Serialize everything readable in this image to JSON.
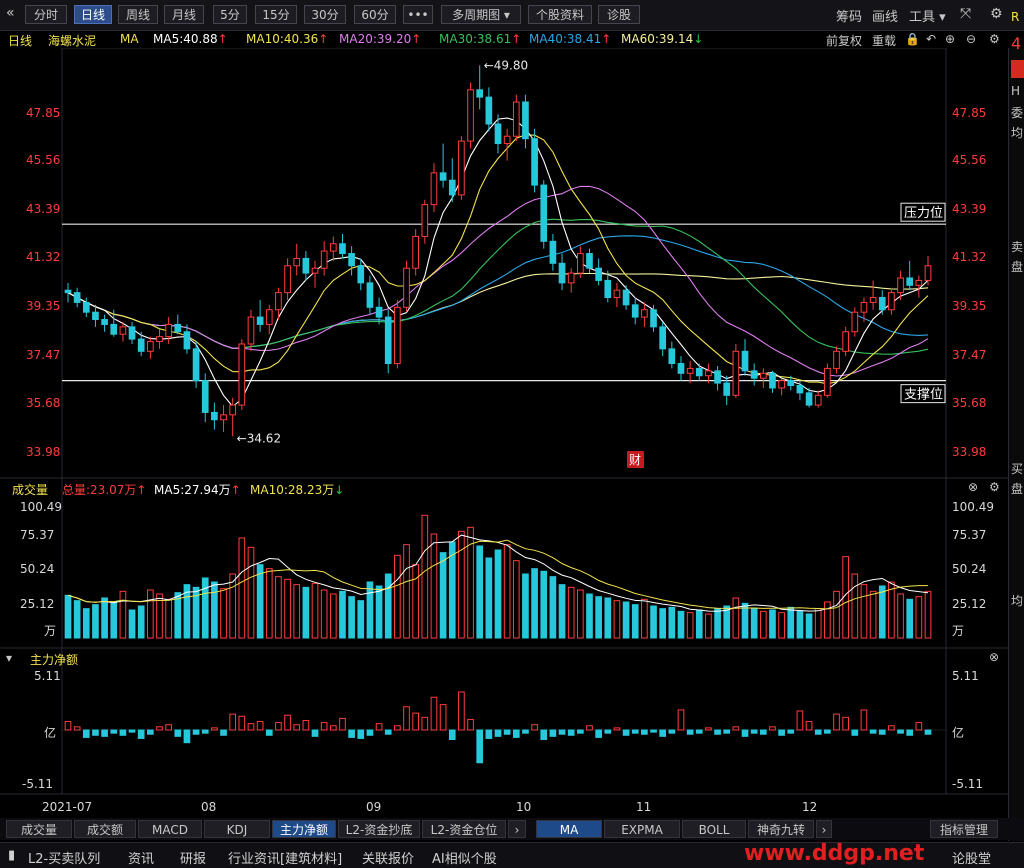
{
  "toolbar": {
    "back_icon": "«",
    "periods": [
      "分时",
      "日线",
      "周线",
      "月线",
      "5分",
      "15分",
      "30分",
      "60分"
    ],
    "active_period": "日线",
    "more": "•••",
    "multi_period": "多周期图",
    "stock_info": "个股资料",
    "diagnose": "诊股",
    "right_items": [
      "筹码",
      "画线",
      "工具"
    ]
  },
  "legend": {
    "period": "日线",
    "stock": "海螺水泥",
    "ma": "MA",
    "items": [
      {
        "text": "MA5:40.88",
        "arrow": "↑",
        "color": "#ffffff"
      },
      {
        "text": "MA10:40.36",
        "arrow": "↑",
        "color": "#f2e34c"
      },
      {
        "text": "MA20:39.20",
        "arrow": "↑",
        "color": "#e07cf0"
      },
      {
        "text": "MA30:38.61",
        "arrow": "↑",
        "color": "#36c05a"
      },
      {
        "text": "MA40:38.41",
        "arrow": "↑",
        "color": "#2ba6e6"
      },
      {
        "text": "MA60:39.14",
        "arrow": "↓",
        "color": "#f5f09c"
      }
    ],
    "right": [
      "前复权",
      "重载"
    ]
  },
  "price_axis": [
    "47.85",
    "45.56",
    "43.39",
    "41.32",
    "39.35",
    "37.47",
    "35.68",
    "33.98"
  ],
  "annotations": {
    "high_label": "←49.80",
    "low_label": "←34.62",
    "pressure": "压力位",
    "support": "支撑位",
    "fin_badge": "财"
  },
  "volume_panel": {
    "title": "成交量",
    "total": "总量:23.07万",
    "total_arrow": "↑",
    "ma5": "MA5:27.94万",
    "ma5_arrow": "↑",
    "ma10": "MA10:28.23万",
    "ma10_arrow": "↓",
    "axis": [
      "100.49",
      "75.37",
      "50.24",
      "25.12"
    ],
    "unit": "万"
  },
  "flow_panel": {
    "title": "主力净额",
    "axis_top": "5.11",
    "axis_mid": "亿",
    "axis_bottom": "-5.11"
  },
  "x_axis": [
    "2021-07",
    "08",
    "09",
    "10",
    "11",
    "12"
  ],
  "indicator_tabs": [
    "成交量",
    "成交额",
    "MACD",
    "KDJ",
    "主力净额",
    "L2-资金抄底",
    "L2-资金仓位"
  ],
  "active_indicator": "主力净额",
  "ma_tabs": [
    "MA",
    "EXPMA",
    "BOLL",
    "神奇九转"
  ],
  "active_ma_tab": "MA",
  "indicator_manage": "指标管理",
  "status_bar": [
    "L2-买卖队列",
    "资讯",
    "研报",
    "行业资讯[建筑材料]",
    "关联报价",
    "AI相似个股"
  ],
  "status_right": "论股堂",
  "watermark": "www.ddgp.net",
  "right_strip": [
    "R",
    "4",
    "H",
    "委",
    "均",
    "卖",
    "盘",
    "买",
    "盘",
    "均"
  ],
  "colors": {
    "up": "#ff3c3c",
    "down": "#28c8dc",
    "bg": "#000000",
    "accent": "#2d4c8c"
  },
  "chart_data": {
    "type": "candlestick",
    "price_range": [
      33.98,
      49.8
    ],
    "high": 49.8,
    "low": 34.62,
    "pressure_level": 43.3,
    "support_level": 36.9,
    "x_labels": [
      "2021-07",
      "08",
      "09",
      "10",
      "11",
      "12"
    ],
    "ohlc": [
      [
        40.6,
        40.9,
        40.1,
        40.5
      ],
      [
        40.5,
        40.7,
        39.9,
        40.1
      ],
      [
        40.1,
        40.3,
        39.5,
        39.7
      ],
      [
        39.7,
        40.0,
        39.1,
        39.4
      ],
      [
        39.4,
        39.6,
        38.9,
        39.2
      ],
      [
        39.2,
        39.8,
        38.7,
        38.8
      ],
      [
        38.8,
        39.3,
        38.5,
        39.1
      ],
      [
        39.1,
        39.3,
        38.4,
        38.6
      ],
      [
        38.6,
        38.9,
        37.9,
        38.1
      ],
      [
        38.1,
        38.7,
        37.8,
        38.5
      ],
      [
        38.5,
        39.0,
        38.2,
        38.7
      ],
      [
        38.7,
        39.5,
        38.4,
        39.2
      ],
      [
        39.2,
        39.6,
        38.8,
        38.9
      ],
      [
        38.9,
        39.2,
        38.0,
        38.2
      ],
      [
        38.2,
        38.5,
        36.6,
        36.9
      ],
      [
        36.9,
        37.2,
        35.2,
        35.6
      ],
      [
        35.6,
        36.0,
        34.9,
        35.3
      ],
      [
        35.3,
        35.9,
        34.8,
        35.5
      ],
      [
        35.5,
        36.2,
        34.62,
        35.9
      ],
      [
        35.9,
        38.6,
        35.7,
        38.4
      ],
      [
        38.4,
        39.8,
        38.1,
        39.5
      ],
      [
        39.5,
        40.2,
        38.9,
        39.2
      ],
      [
        39.2,
        40.0,
        38.8,
        39.8
      ],
      [
        39.8,
        40.7,
        39.4,
        40.5
      ],
      [
        40.5,
        41.9,
        40.2,
        41.6
      ],
      [
        41.6,
        42.5,
        41.2,
        41.9
      ],
      [
        41.9,
        42.2,
        41.0,
        41.3
      ],
      [
        41.3,
        41.8,
        40.7,
        41.5
      ],
      [
        41.5,
        42.6,
        41.2,
        42.2
      ],
      [
        42.2,
        42.8,
        41.8,
        42.5
      ],
      [
        42.5,
        42.9,
        41.9,
        42.1
      ],
      [
        42.1,
        42.4,
        41.2,
        41.6
      ],
      [
        41.6,
        41.9,
        40.6,
        40.9
      ],
      [
        40.9,
        41.2,
        39.6,
        39.9
      ],
      [
        39.9,
        40.3,
        39.2,
        39.5
      ],
      [
        39.5,
        39.8,
        37.2,
        37.6
      ],
      [
        37.6,
        40.2,
        37.4,
        39.9
      ],
      [
        39.9,
        41.8,
        39.7,
        41.5
      ],
      [
        41.5,
        43.1,
        41.2,
        42.8
      ],
      [
        42.8,
        44.3,
        42.5,
        44.1
      ],
      [
        44.1,
        45.8,
        43.8,
        45.4
      ],
      [
        45.4,
        46.6,
        44.8,
        45.1
      ],
      [
        45.1,
        46.0,
        44.2,
        44.5
      ],
      [
        44.5,
        46.9,
        44.3,
        46.7
      ],
      [
        46.7,
        49.1,
        46.4,
        48.8
      ],
      [
        48.8,
        49.8,
        48.0,
        48.5
      ],
      [
        48.5,
        48.9,
        47.1,
        47.4
      ],
      [
        47.4,
        47.8,
        46.2,
        46.6
      ],
      [
        46.6,
        47.2,
        45.9,
        46.9
      ],
      [
        46.9,
        48.6,
        46.7,
        48.3
      ],
      [
        48.3,
        48.6,
        46.4,
        46.8
      ],
      [
        46.8,
        47.2,
        44.6,
        44.9
      ],
      [
        44.9,
        45.1,
        42.3,
        42.6
      ],
      [
        42.6,
        42.9,
        41.4,
        41.7
      ],
      [
        41.7,
        42.1,
        40.6,
        40.9
      ],
      [
        40.9,
        41.5,
        40.5,
        41.3
      ],
      [
        41.3,
        42.4,
        41.1,
        42.1
      ],
      [
        42.1,
        42.3,
        41.3,
        41.5
      ],
      [
        41.5,
        41.9,
        40.8,
        41.0
      ],
      [
        41.0,
        41.4,
        40.1,
        40.3
      ],
      [
        40.3,
        40.9,
        39.9,
        40.6
      ],
      [
        40.6,
        40.8,
        39.8,
        40.0
      ],
      [
        40.0,
        40.3,
        39.2,
        39.5
      ],
      [
        39.5,
        40.1,
        39.1,
        39.8
      ],
      [
        39.8,
        40.0,
        38.9,
        39.1
      ],
      [
        39.1,
        39.3,
        37.9,
        38.2
      ],
      [
        38.2,
        38.5,
        37.4,
        37.6
      ],
      [
        37.6,
        37.9,
        36.9,
        37.2
      ],
      [
        37.2,
        37.7,
        36.8,
        37.4
      ],
      [
        37.4,
        37.6,
        36.9,
        37.1
      ],
      [
        37.1,
        37.6,
        36.8,
        37.3
      ],
      [
        37.3,
        37.5,
        36.5,
        36.8
      ],
      [
        36.8,
        37.1,
        35.9,
        36.3
      ],
      [
        36.3,
        38.4,
        36.2,
        38.1
      ],
      [
        38.1,
        38.6,
        37.1,
        37.3
      ],
      [
        37.3,
        37.6,
        36.7,
        37.0
      ],
      [
        37.0,
        37.4,
        36.6,
        37.2
      ],
      [
        37.2,
        37.3,
        36.4,
        36.6
      ],
      [
        36.6,
        37.0,
        36.3,
        36.9
      ],
      [
        36.9,
        37.1,
        36.5,
        36.7
      ],
      [
        36.7,
        36.9,
        36.1,
        36.4
      ],
      [
        36.4,
        36.6,
        35.8,
        35.9
      ],
      [
        35.9,
        36.5,
        35.8,
        36.3
      ],
      [
        36.3,
        37.6,
        36.2,
        37.4
      ],
      [
        37.4,
        38.3,
        37.2,
        38.1
      ],
      [
        38.1,
        39.1,
        37.9,
        38.9
      ],
      [
        38.9,
        39.9,
        38.7,
        39.7
      ],
      [
        39.7,
        40.3,
        39.3,
        40.1
      ],
      [
        40.1,
        41.0,
        39.8,
        40.3
      ],
      [
        40.3,
        40.6,
        39.6,
        39.8
      ],
      [
        39.8,
        40.7,
        39.6,
        40.5
      ],
      [
        40.5,
        41.4,
        40.2,
        41.1
      ],
      [
        41.1,
        41.8,
        40.6,
        40.8
      ],
      [
        40.8,
        41.2,
        40.3,
        41.0
      ],
      [
        41.0,
        42.0,
        40.8,
        41.6
      ]
    ],
    "volume": [
      32,
      28,
      22,
      25,
      30,
      27,
      35,
      21,
      24,
      36,
      33,
      29,
      34,
      40,
      38,
      45,
      42,
      37,
      48,
      75,
      68,
      55,
      52,
      46,
      44,
      40,
      38,
      41,
      36,
      33,
      35,
      31,
      28,
      42,
      39,
      48,
      62,
      70,
      55,
      92,
      78,
      64,
      72,
      80,
      83,
      69,
      60,
      66,
      70,
      58,
      48,
      52,
      50,
      46,
      40,
      38,
      36,
      33,
      31,
      30,
      28,
      27,
      25,
      29,
      24,
      22,
      23,
      20,
      19,
      21,
      18,
      22,
      24,
      30,
      26,
      22,
      20,
      21,
      19,
      23,
      20,
      18,
      22,
      27,
      35,
      61,
      48,
      40,
      35,
      39,
      42,
      33,
      29,
      31,
      35
    ],
    "flow": [
      0.8,
      0.3,
      -0.7,
      -0.5,
      -0.6,
      -0.3,
      -0.5,
      -0.2,
      -0.8,
      -0.4,
      0.3,
      0.5,
      -0.6,
      -1.2,
      -0.4,
      -0.3,
      0.2,
      -0.5,
      1.5,
      1.3,
      0.6,
      0.8,
      -0.5,
      0.7,
      1.4,
      0.5,
      0.9,
      -0.6,
      0.7,
      0.4,
      1.1,
      -0.7,
      -0.8,
      -0.5,
      0.6,
      -0.4,
      0.4,
      2.2,
      1.6,
      1.2,
      3.1,
      2.4,
      -0.9,
      3.6,
      1.0,
      -3.1,
      -0.8,
      -0.6,
      -0.4,
      -0.7,
      -0.3,
      0.5,
      -0.9,
      -0.6,
      -0.4,
      -0.5,
      -0.3,
      0.4,
      -0.7,
      -0.3,
      0.2,
      -0.5,
      -0.3,
      -0.4,
      -0.2,
      -0.6,
      -0.3,
      1.9,
      -0.4,
      -0.3,
      0.2,
      -0.4,
      -0.3,
      0.3,
      -0.6,
      -0.3,
      -0.4,
      0.3,
      -0.5,
      -0.3,
      1.8,
      0.8,
      -0.4,
      -0.3,
      1.5,
      1.2,
      -0.5,
      1.9,
      -0.3,
      -0.4,
      0.4,
      -0.3,
      -0.5,
      0.7,
      -0.4
    ],
    "volume_range": [
      0,
      100.49
    ],
    "flow_range": [
      -5.11,
      5.11
    ]
  }
}
